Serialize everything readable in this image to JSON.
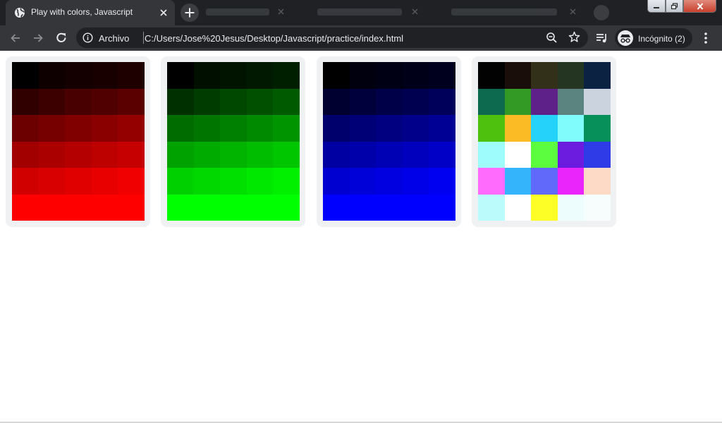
{
  "browser": {
    "tab": {
      "title": "Play with colors, Javascript"
    },
    "address_bar": {
      "site_label": "Archivo",
      "url": "C:/Users/Jose%20Jesus/Desktop/Javascript/practice/index.html"
    },
    "incognito_label": "Incógnito (2)"
  },
  "colors": {
    "titlebar": "#202124",
    "active_tab": "#35363a",
    "omnibox": "#202124",
    "card_background": "#f0f1f3"
  },
  "icons": [
    "globe-icon",
    "close-icon",
    "plus-icon",
    "back-arrow-icon",
    "forward-arrow-icon",
    "reload-icon",
    "info-icon",
    "zoom-out-icon",
    "star-icon",
    "media-queue-icon",
    "incognito-icon",
    "more-vert-icon",
    "minimize-icon",
    "maximize-icon",
    "window-close-icon"
  ],
  "grids": [
    {
      "name": "red",
      "cells": [
        "#000000",
        "#0f0000",
        "#140000",
        "#190000",
        "#1e0000",
        "#300000",
        "#3c0000",
        "#480000",
        "#500000",
        "#5a0000",
        "#6c0000",
        "#760000",
        "#800000",
        "#8a0000",
        "#940000",
        "#a20000",
        "#ab0000",
        "#b40000",
        "#bd0000",
        "#c60000",
        "#d00000",
        "#d80000",
        "#e00000",
        "#e80000",
        "#f00000",
        "#ff0000",
        "#ff0000",
        "#ff0000",
        "#ff0000",
        "#ff0000"
      ]
    },
    {
      "name": "green",
      "cells": [
        "#000000",
        "#000f00",
        "#001400",
        "#001900",
        "#001e00",
        "#003000",
        "#003c00",
        "#004800",
        "#005000",
        "#005a00",
        "#006c00",
        "#007600",
        "#008000",
        "#008a00",
        "#009400",
        "#00a200",
        "#00ab00",
        "#00b400",
        "#00bd00",
        "#00c600",
        "#00d000",
        "#00d800",
        "#00e000",
        "#00e800",
        "#00f000",
        "#00ff00",
        "#00ff00",
        "#00ff00",
        "#00ff00",
        "#00ff00"
      ]
    },
    {
      "name": "blue",
      "cells": [
        "#000000",
        "#00000f",
        "#000014",
        "#000019",
        "#00001e",
        "#000030",
        "#00003c",
        "#000048",
        "#000050",
        "#00005a",
        "#00006c",
        "#000076",
        "#000080",
        "#00008a",
        "#000094",
        "#0000a2",
        "#0000ab",
        "#0000b4",
        "#0000bd",
        "#0000c6",
        "#0000d0",
        "#0000d8",
        "#0000e0",
        "#0000e8",
        "#0000f0",
        "#0000ff",
        "#0000ff",
        "#0000ff",
        "#0000ff",
        "#0000ff"
      ]
    },
    {
      "name": "random",
      "cells": [
        "#020202",
        "#1a0e0b",
        "#333019",
        "#243521",
        "#0c2243",
        "#0d6a4e",
        "#339b25",
        "#5e2089",
        "#5b8380",
        "#cbd3df",
        "#4dc10e",
        "#fbbb24",
        "#25d2f9",
        "#7ffcfb",
        "#079059",
        "#9ffcfc",
        "#ffffff",
        "#5cfc3f",
        "#6b1cde",
        "#2f3be7",
        "#fe6bfd",
        "#33b4fb",
        "#6069fa",
        "#ea25fc",
        "#fddac6",
        "#bcfbfc",
        "#ffffff",
        "#fcfe25",
        "#edfdfd",
        "#f7fcfd"
      ]
    }
  ]
}
